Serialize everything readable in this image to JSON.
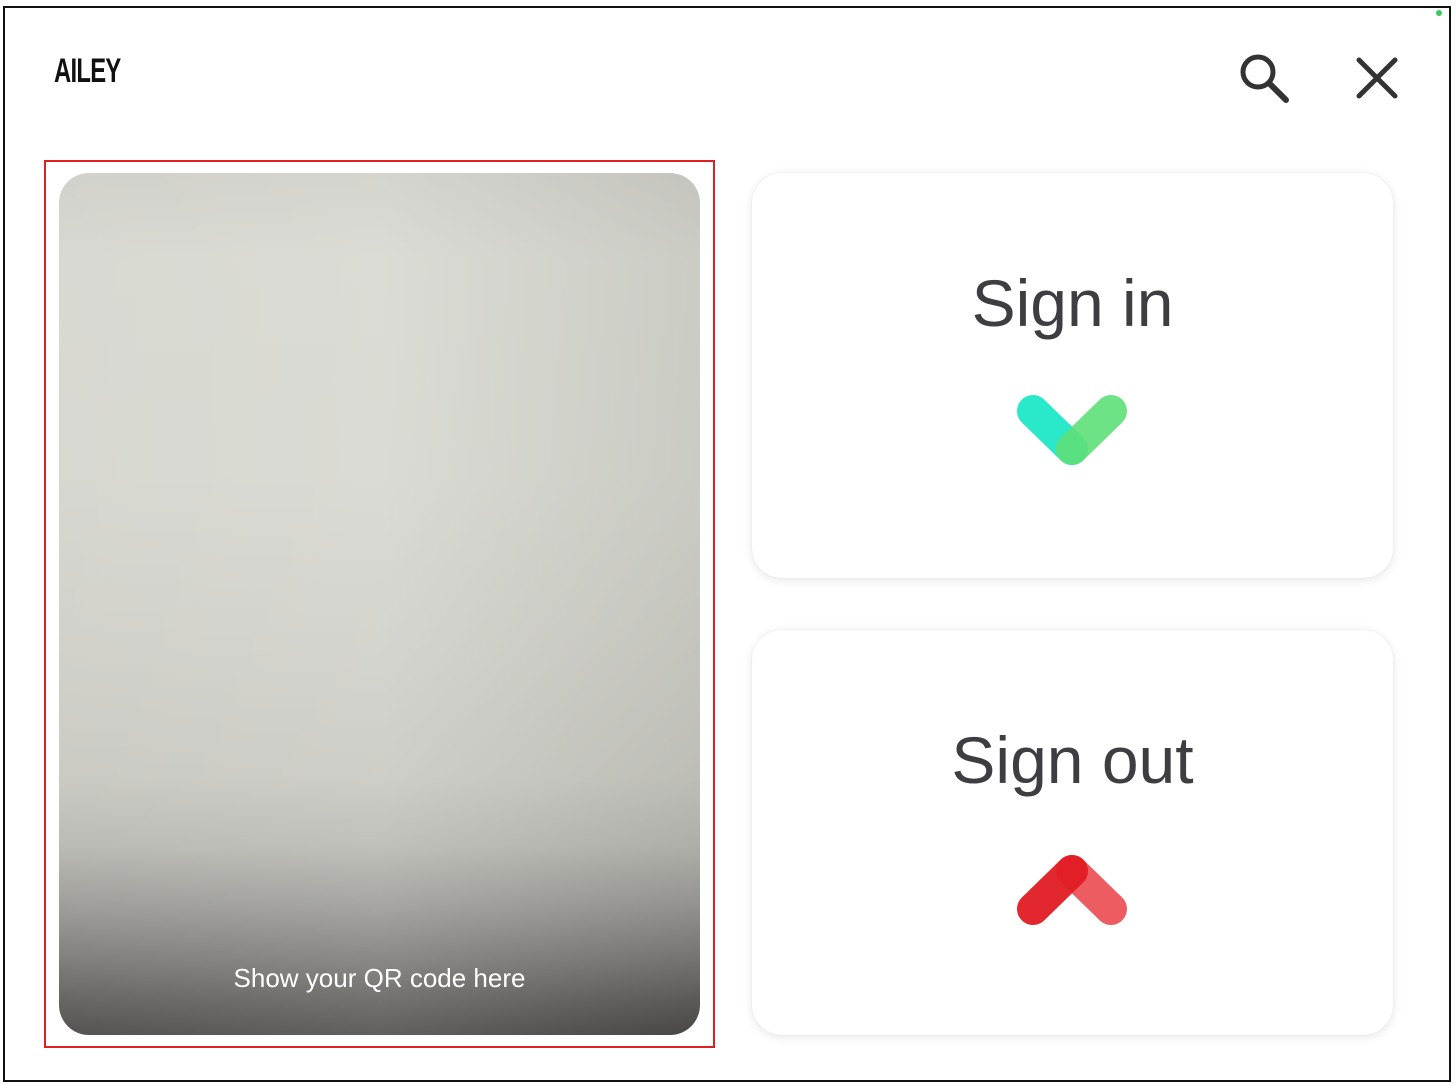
{
  "app": {
    "brand": "AILEY"
  },
  "header": {
    "search_icon": "search-icon",
    "close_icon": "close-icon"
  },
  "camera": {
    "hint": "Show your QR code here"
  },
  "actions": {
    "sign_in": {
      "label": "Sign in",
      "icon": "chevron-down-icon",
      "colors": [
        "#1ee8c8",
        "#5ee07a",
        "#2fce7a"
      ]
    },
    "sign_out": {
      "label": "Sign out",
      "icon": "chevron-up-icon",
      "colors": [
        "#e21c24",
        "#ec4b50"
      ]
    }
  },
  "colors": {
    "status_dot": "#3cc95e",
    "highlight_border": "#e02020"
  }
}
